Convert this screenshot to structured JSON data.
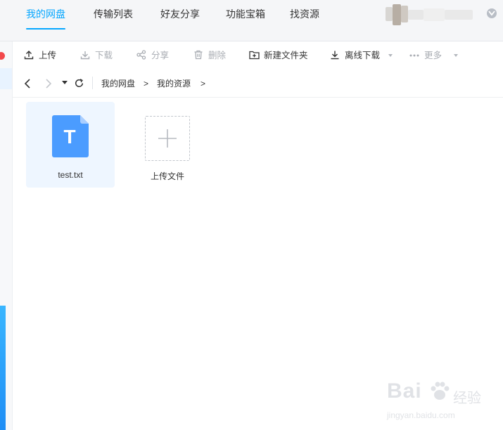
{
  "nav": {
    "tabs": [
      {
        "label": "我的网盘",
        "active": true
      },
      {
        "label": "传输列表"
      },
      {
        "label": "好友分享"
      },
      {
        "label": "功能宝箱"
      },
      {
        "label": "找资源"
      }
    ]
  },
  "toolbar": {
    "upload": "上传",
    "download": "下载",
    "share": "分享",
    "delete": "删除",
    "new_folder": "新建文件夹",
    "offline_download": "离线下载",
    "more": "更多"
  },
  "breadcrumb": {
    "items": [
      "我的网盘",
      "我的资源"
    ],
    "separator": ">"
  },
  "files": [
    {
      "name": "test.txt",
      "type_letter": "T",
      "icon": "text-file-icon"
    }
  ],
  "upload_tile": {
    "label": "上传文件"
  },
  "watermark": {
    "text": "Bai",
    "text_zh": "经验",
    "url": "jingyan.baidu.com"
  },
  "colors": {
    "accent": "#06a7ff",
    "file_icon": "#4b9cff",
    "selected_bg": "#eef6ff",
    "disabled_text": "#a9adb3"
  }
}
